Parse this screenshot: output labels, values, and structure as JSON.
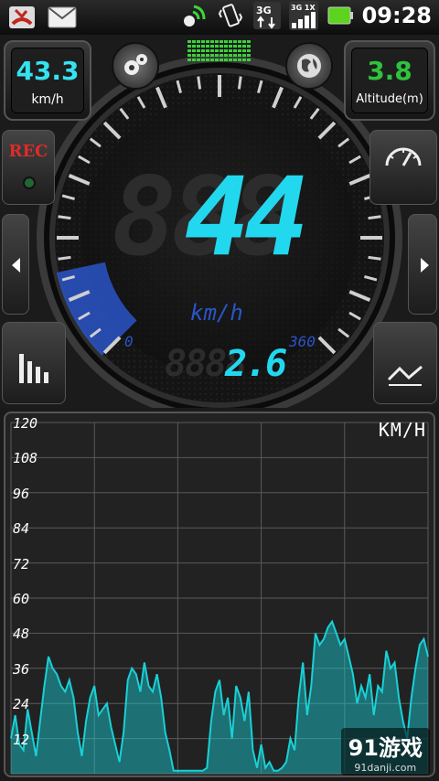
{
  "status_bar": {
    "time": "09:28",
    "network_3g_label": "3G",
    "network_3g1x_label": "3G 1X"
  },
  "speed_box": {
    "value": "43.3",
    "unit": "km/h",
    "value_color": "#33e3f0"
  },
  "altitude_box": {
    "value": "3.8",
    "label": "Altitude(m)",
    "value_color": "#2fc23c"
  },
  "rec_button": {
    "label": "REC"
  },
  "gauge": {
    "digital_speed_bg": "888",
    "digital_speed": "44",
    "unit": "km/h",
    "scale_min": "0",
    "scale_max": "360",
    "distance_bg": "8888",
    "distance": "2.6",
    "accent_color": "#22d8ee",
    "progress_color": "#2a55c8",
    "speed_fraction": 0.122
  },
  "chart": {
    "unit_label": "KM/H",
    "y_ticks": [
      "120",
      "108",
      "96",
      "84",
      "72",
      "60",
      "48",
      "36",
      "24",
      "12"
    ]
  },
  "chart_data": {
    "type": "area",
    "title": "",
    "ylabel": "KM/H",
    "ylim": [
      0,
      120
    ],
    "grid": true,
    "x": [
      0,
      1,
      2,
      3,
      4,
      5,
      6,
      7,
      8,
      9,
      10,
      11,
      12,
      13,
      14,
      15,
      16,
      17,
      18,
      19,
      20,
      21,
      22,
      23,
      24,
      25,
      26,
      27,
      28,
      29,
      30,
      31,
      32,
      33,
      34,
      35,
      36,
      37,
      38,
      39,
      40,
      41,
      42,
      43,
      44,
      45,
      46,
      47,
      48,
      49,
      50,
      51,
      52,
      53,
      54,
      55,
      56,
      57,
      58,
      59,
      60,
      61,
      62,
      63,
      64,
      65,
      66,
      67,
      68,
      69,
      70,
      71,
      72,
      73,
      74,
      75,
      76,
      77,
      78,
      79,
      80,
      81,
      82,
      83,
      84,
      85,
      86,
      87,
      88,
      89,
      90,
      91,
      92,
      93,
      94,
      95,
      96,
      97,
      98,
      99,
      100
    ],
    "values": [
      12,
      20,
      10,
      8,
      22,
      14,
      6,
      18,
      30,
      40,
      36,
      34,
      30,
      28,
      32,
      26,
      14,
      6,
      18,
      26,
      30,
      20,
      22,
      24,
      16,
      10,
      4,
      14,
      32,
      36,
      34,
      28,
      38,
      30,
      28,
      34,
      26,
      14,
      8,
      1,
      1,
      1,
      1,
      1,
      1,
      1,
      1,
      2,
      18,
      28,
      32,
      20,
      26,
      12,
      30,
      26,
      18,
      28,
      8,
      2,
      10,
      2,
      4,
      1,
      1,
      2,
      4,
      12,
      8,
      26,
      38,
      20,
      30,
      48,
      44,
      46,
      50,
      52,
      48,
      44,
      46,
      40,
      34,
      24,
      30,
      26,
      34,
      20,
      30,
      28,
      42,
      36,
      38,
      26,
      18,
      12,
      26,
      36,
      44,
      46,
      40
    ],
    "series_color": "#19d0d6"
  },
  "watermark": {
    "text": "91游戏",
    "subtext": "91danji.com"
  }
}
